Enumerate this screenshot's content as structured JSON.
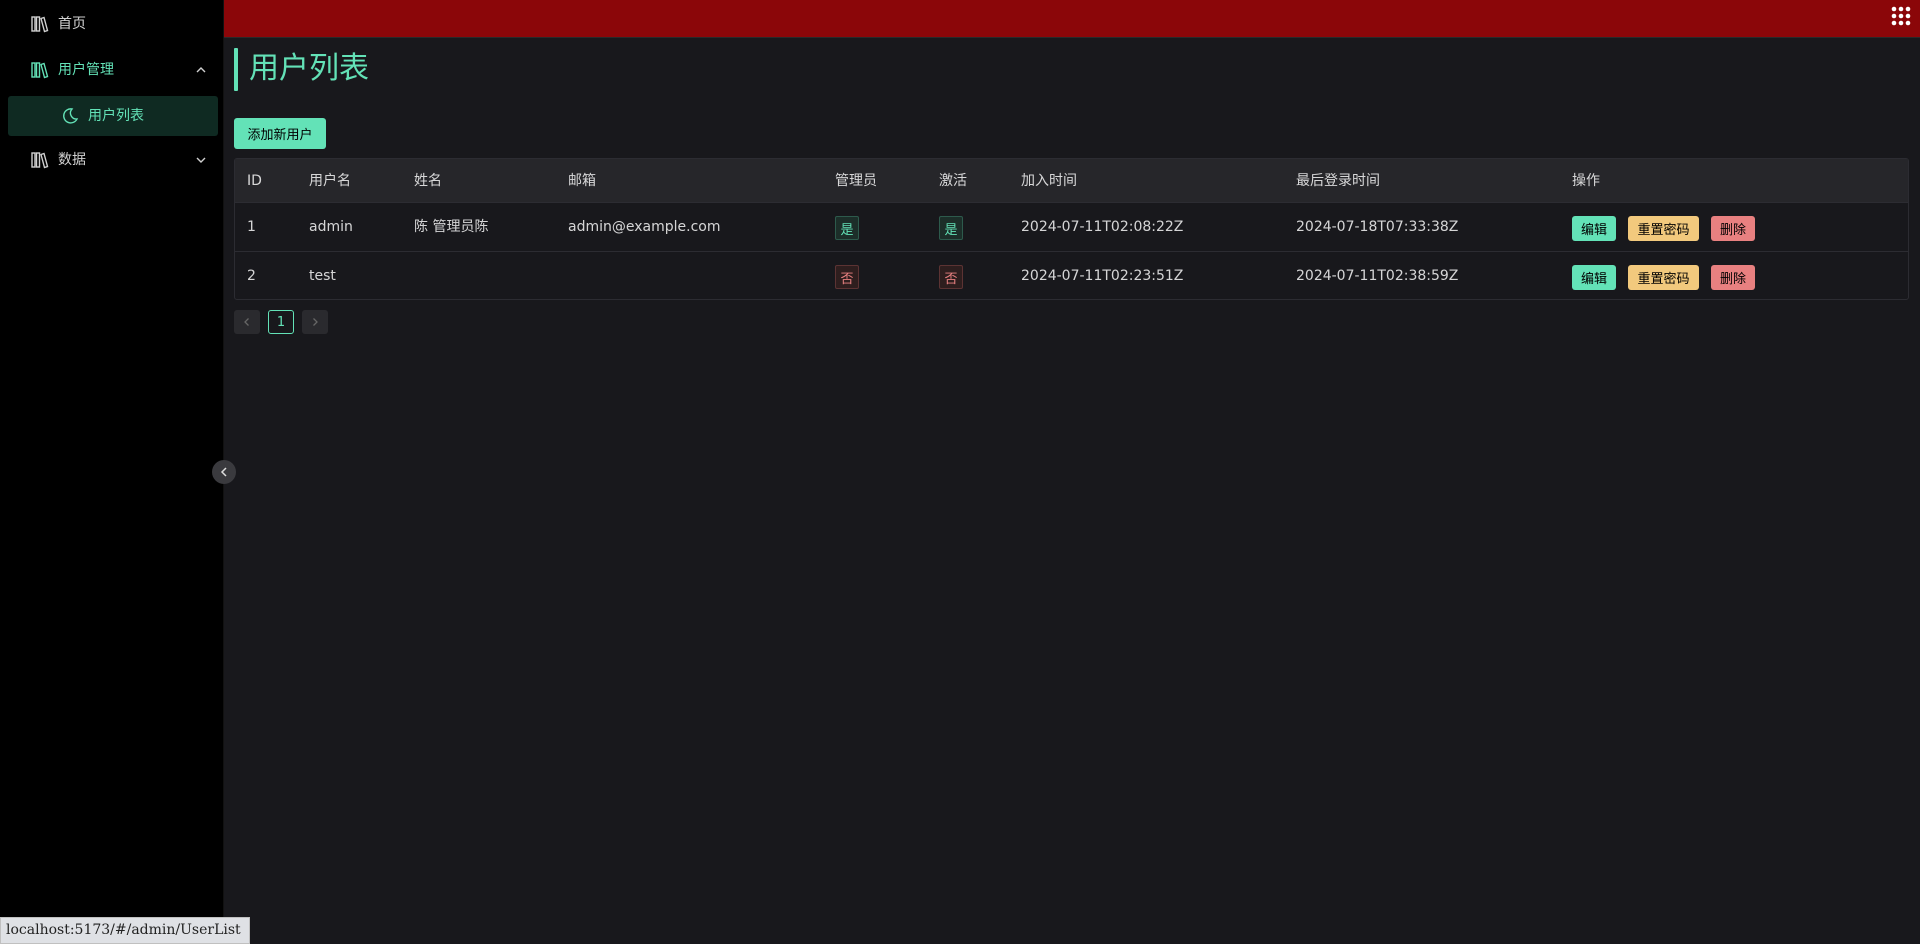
{
  "sidebar": {
    "items": [
      {
        "label": "首页",
        "icon": "book-shelf-icon"
      },
      {
        "label": "用户管理",
        "icon": "book-shelf-icon",
        "expanded": true,
        "children": [
          {
            "label": "用户列表",
            "icon": "moon-icon",
            "selected": true
          }
        ]
      },
      {
        "label": "数据",
        "icon": "book-shelf-icon",
        "expanded": false
      }
    ]
  },
  "header": {
    "apps_icon": "grid-apps-icon",
    "color": "#8b0609"
  },
  "main": {
    "title": "用户列表",
    "add_button": "添加新用户",
    "table": {
      "columns": [
        "ID",
        "用户名",
        "姓名",
        "邮箱",
        "管理员",
        "激活",
        "加入时间",
        "最后登录时间",
        "操作"
      ],
      "rows": [
        {
          "id": "1",
          "username": "admin",
          "name": "陈 管理员陈",
          "email": "admin@example.com",
          "admin": "是",
          "active": "是",
          "joined": "2024-07-11T02:08:22Z",
          "last_login": "2024-07-18T07:33:38Z"
        },
        {
          "id": "2",
          "username": "test",
          "name": "",
          "email": "",
          "admin": "否",
          "active": "否",
          "joined": "2024-07-11T02:23:51Z",
          "last_login": "2024-07-11T02:38:59Z"
        }
      ],
      "actions": {
        "edit": "编辑",
        "reset": "重置密码",
        "delete": "删除"
      }
    },
    "pagination": {
      "current": "1"
    }
  },
  "status_url": "localhost:5173/#/admin/UserList",
  "colors": {
    "accent": "#63e2b7",
    "warning": "#f2c97d",
    "danger": "#e88080"
  }
}
